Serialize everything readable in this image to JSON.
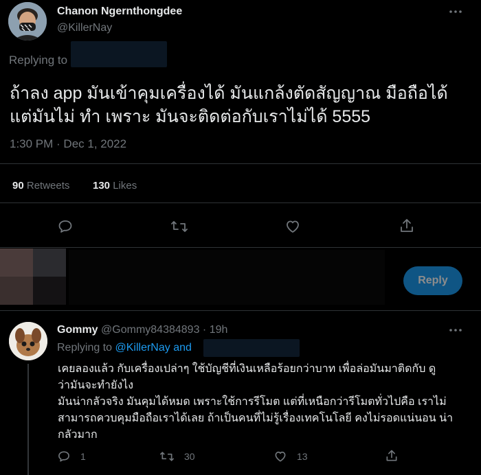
{
  "tweet": {
    "author_name": "Chanon Ngernthongdee",
    "author_handle": "@KillerNay",
    "replying_to_label": "Replying to",
    "text_line1": "ถ้าลง app มันเข้าคุมเครื่องได้ มันแกล้งตัดสัญญาณ มือถือได้",
    "text_line2": "แต่มันไม่ ทำ เพราะ มันจะติดต่อกับเราไม่ได้ 5555",
    "timestamp": "1:30 PM · Dec 1, 2022",
    "retweets_count": "90",
    "retweets_label": "Retweets",
    "likes_count": "130",
    "likes_label": "Likes"
  },
  "composer": {
    "reply_button": "Reply"
  },
  "reply": {
    "author_name": "Gommy",
    "author_handle": "@Gommy84384893",
    "time": "· 19h",
    "replying_to_label": "Replying to",
    "replying_to_mention": "@KillerNay and",
    "text_lines": [
      "เคยลองแล้ว กับเครื่องเปล่าๆ ใช้บัญชีที่เงินเหลือร้อยกว่าบาท เพื่อล่อมันมาติดกับ ดู",
      "ว่ามันจะทำยังไง",
      "มันน่ากลัวจริง มันคุมได้หมด เพราะใช้การรีโมต แต่ที่เหนือกว่ารีโมตทั่วไปคือ เราไม่",
      "สามารถควบคุมมือถือเราได้เลย ถ้าเป็นคนที่ไม่รู้เรื่องเทคโนโลยี คงไม่รอดแน่นอน น่า",
      "กลัวมาก"
    ],
    "replies_count": "1",
    "retweets_count": "30",
    "likes_count": "13"
  },
  "icons": {
    "more": "more-icon",
    "reply": "reply-icon",
    "retweet": "retweet-icon",
    "like": "heart-icon",
    "share": "share-icon"
  },
  "colors": {
    "background": "#000000",
    "accent": "#1d9bf0",
    "muted": "#71767b",
    "text": "#e7e9ea",
    "divider": "#2f3336"
  }
}
